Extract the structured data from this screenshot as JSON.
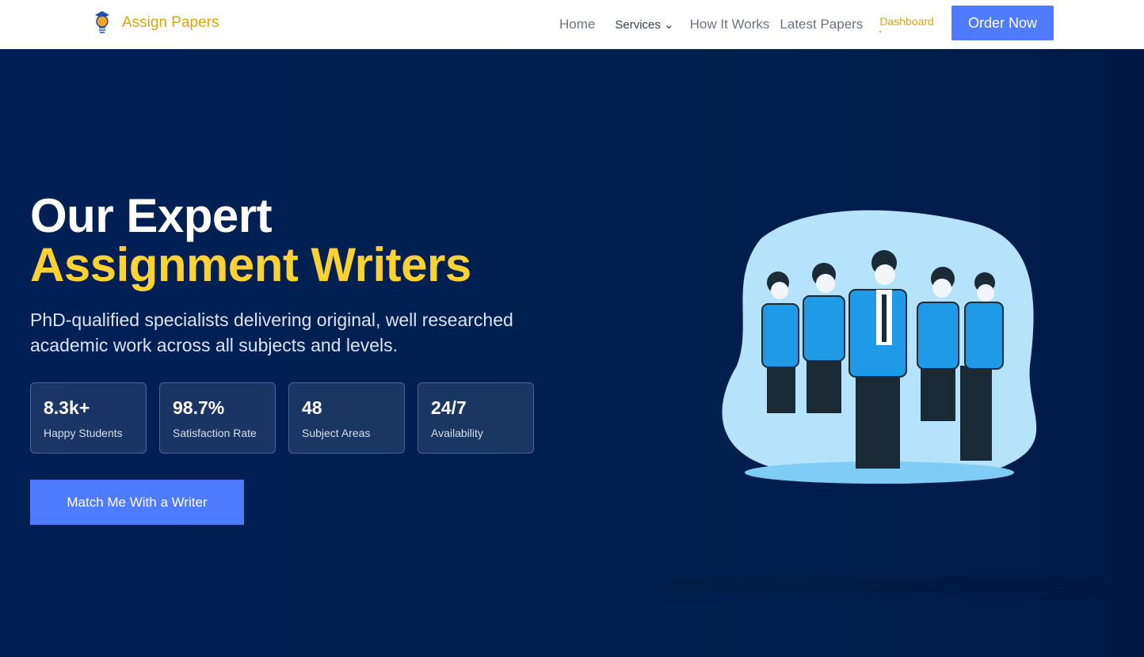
{
  "brand": {
    "name": "Assign Papers",
    "icon": "lightbulb-graduation-cap-icon",
    "color": "#d4a514"
  },
  "nav": {
    "items": [
      {
        "label": "Home"
      },
      {
        "label": "Services"
      },
      {
        "label": "How It Works"
      },
      {
        "label": "Latest Papers"
      },
      {
        "label": "Dashboard"
      }
    ],
    "order_label": "Order Now"
  },
  "hero": {
    "title_line1": "Our Expert",
    "title_line2": "Assignment Writers",
    "subtitle": "PhD-qualified specialists delivering original, well researched academic work across all subjects and levels.",
    "stats": [
      {
        "value": "8.3k+",
        "label": "Happy Students"
      },
      {
        "value": "98.7%",
        "label": "Satisfaction Rate"
      },
      {
        "value": "48",
        "label": "Subject Areas"
      },
      {
        "value": "24/7",
        "label": "Availability"
      }
    ],
    "cta_label": "Match Me With a Writer"
  },
  "colors": {
    "accent": "#4f7bff",
    "highlight": "#ffd232",
    "background": "#001e52"
  }
}
